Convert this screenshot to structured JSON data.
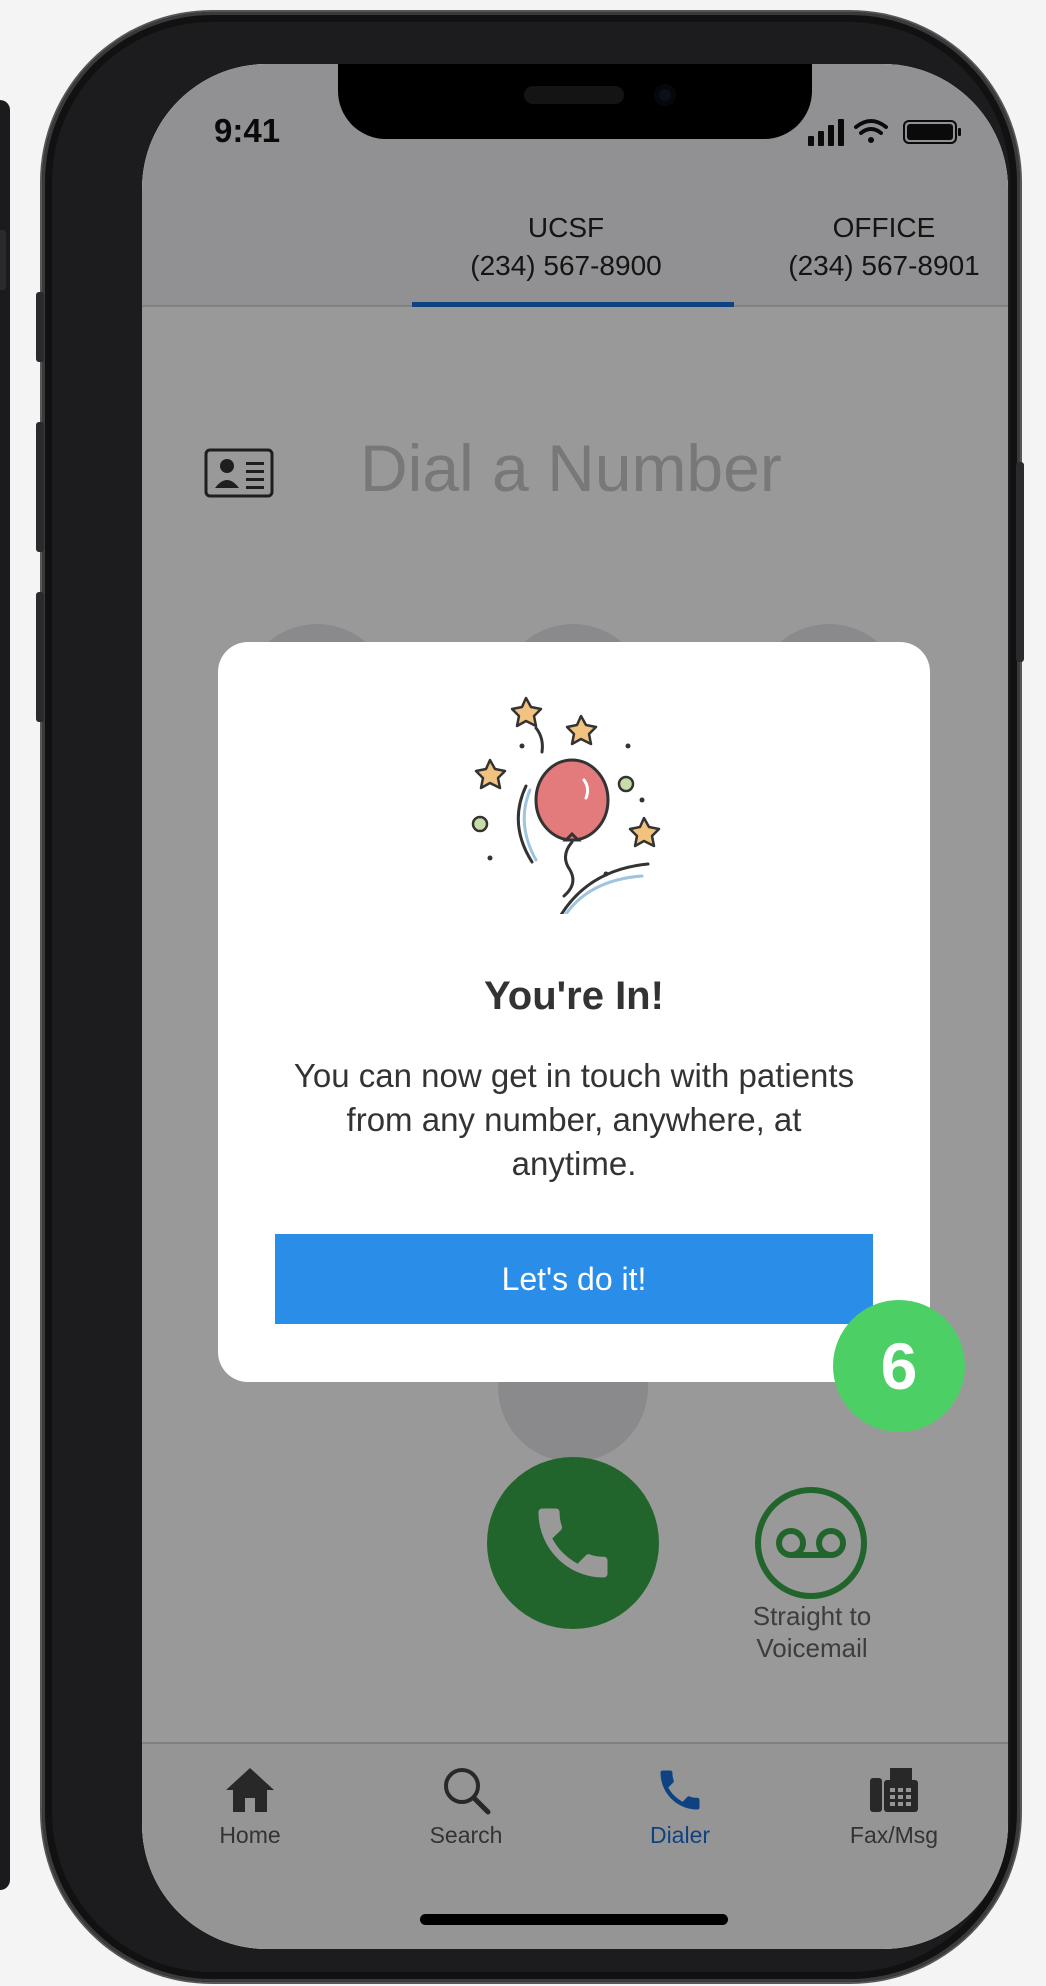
{
  "status_bar": {
    "time": "9:41"
  },
  "line_tabs": [
    {
      "name": "UCSF",
      "number": "(234) 567-8900"
    },
    {
      "name": "OFFICE",
      "number": "(234) 567-8901"
    }
  ],
  "dialer": {
    "placeholder": "Dial a Number",
    "voicemail_label_line1": "Straight to",
    "voicemail_label_line2": "Voicemail"
  },
  "bottom_tabs": [
    {
      "label": "Home",
      "icon": "home-icon"
    },
    {
      "label": "Search",
      "icon": "search-icon"
    },
    {
      "label": "Dialer",
      "icon": "phone-icon",
      "active": true
    },
    {
      "label": "Fax/Msg",
      "icon": "fax-icon"
    }
  ],
  "modal": {
    "title": "You're In!",
    "body": "You can now get in touch with patients from any number, anywhere, at anytime.",
    "button_label": "Let's do it!"
  },
  "step_badge": "6",
  "colors": {
    "accent": "#1a6ed8",
    "button": "#2a8de8",
    "call_green": "#3aa84a",
    "badge_green": "#4cd066"
  }
}
